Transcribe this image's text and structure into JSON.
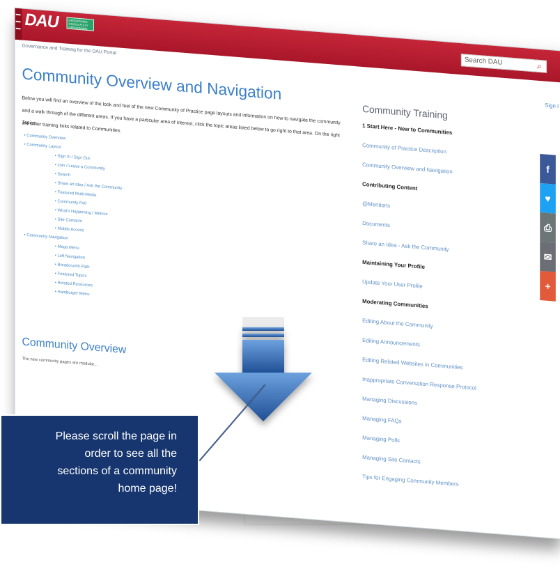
{
  "header": {
    "logo_text": "DAU",
    "status_text": "OPERATIONAL STATUS FULLY OPERATIONAL",
    "search_placeholder": "Search DAU",
    "search_icon": "search-icon"
  },
  "breadcrumb": {
    "text": "Governance and Training for the DAU Portal"
  },
  "sign_in": {
    "label": "Sign I"
  },
  "content": {
    "title": "Community Overview and Navigation",
    "intro": "Below you will find an overview of the look and feel of the new Community of Practice page layouts and information on how to navigate the community and a walk through of the different areas. If you have a particular area of interest, click the topic areas listed below to go right to that area. On the right are other training links related to Communities.",
    "topics_label": "Topics:",
    "topics": [
      {
        "label": "Community Overview",
        "level": 1
      },
      {
        "label": "Community Layout",
        "level": 1
      },
      {
        "label": "Sign In / Sign Out",
        "level": 2
      },
      {
        "label": "Join / Leave a Community",
        "level": 2
      },
      {
        "label": "Search",
        "level": 2
      },
      {
        "label": "Share an Idea / Ask the Community",
        "level": 2
      },
      {
        "label": "Featured Multi-Media",
        "level": 2
      },
      {
        "label": "Community Poll",
        "level": 2
      },
      {
        "label": "What's Happening / Metrics",
        "level": 2
      },
      {
        "label": "Site Contacts",
        "level": 2
      },
      {
        "label": "Mobile Access",
        "level": 2
      },
      {
        "label": "Community Navigation",
        "level": 1
      },
      {
        "label": "Mega Menu",
        "level": 2
      },
      {
        "label": "Left Navigation",
        "level": 2
      },
      {
        "label": "Breadcrumb Path",
        "level": 2
      },
      {
        "label": "Featured Topics",
        "level": 2
      },
      {
        "label": "Related Resources",
        "level": 2
      },
      {
        "label": "Hamburger Menu",
        "level": 2
      }
    ],
    "section_title": "Community Overview",
    "section_text": "The new community pages are modular..."
  },
  "sidebar": {
    "title": "Community Training",
    "items": [
      {
        "type": "head",
        "label": "1 Start Here - New to Communities"
      },
      {
        "type": "link",
        "label": "Community of Practice Description"
      },
      {
        "type": "link",
        "label": "Community Overview and Navigation"
      },
      {
        "type": "head",
        "label": "Contributing Content"
      },
      {
        "type": "link",
        "label": "@Mentions"
      },
      {
        "type": "link",
        "label": "Documents"
      },
      {
        "type": "link",
        "label": "Share an Idea - Ask the Community"
      },
      {
        "type": "head",
        "label": "Maintaining Your Profile"
      },
      {
        "type": "link",
        "label": "Update Your User Profile"
      },
      {
        "type": "head",
        "label": "Moderating Communities"
      },
      {
        "type": "link",
        "label": "Editing About the Community"
      },
      {
        "type": "link",
        "label": "Editing Announcements"
      },
      {
        "type": "link",
        "label": "Editing Related Websites in Communities"
      },
      {
        "type": "link",
        "label": "Inappropriate Conversation Response Protocol"
      },
      {
        "type": "link",
        "label": "Managing Discussions"
      },
      {
        "type": "link",
        "label": "Managing FAQs"
      },
      {
        "type": "link",
        "label": "Managing Polls"
      },
      {
        "type": "link",
        "label": "Managing Site Contacts"
      },
      {
        "type": "link",
        "label": "Tips for Engaging Community Members"
      }
    ]
  },
  "social": [
    {
      "name": "facebook-icon",
      "glyph": "f"
    },
    {
      "name": "twitter-icon",
      "glyph": "♥"
    },
    {
      "name": "print-icon",
      "glyph": "⎙"
    },
    {
      "name": "email-icon",
      "glyph": "✉"
    },
    {
      "name": "plus-icon",
      "glyph": "+"
    }
  ],
  "callout": {
    "text": "Please scroll the page in\norder to see all the\nsections of a community\nhome page!"
  },
  "colors": {
    "header_red": "#c52638",
    "link_blue": "#4a8bc7",
    "callout_navy": "#17366f"
  }
}
